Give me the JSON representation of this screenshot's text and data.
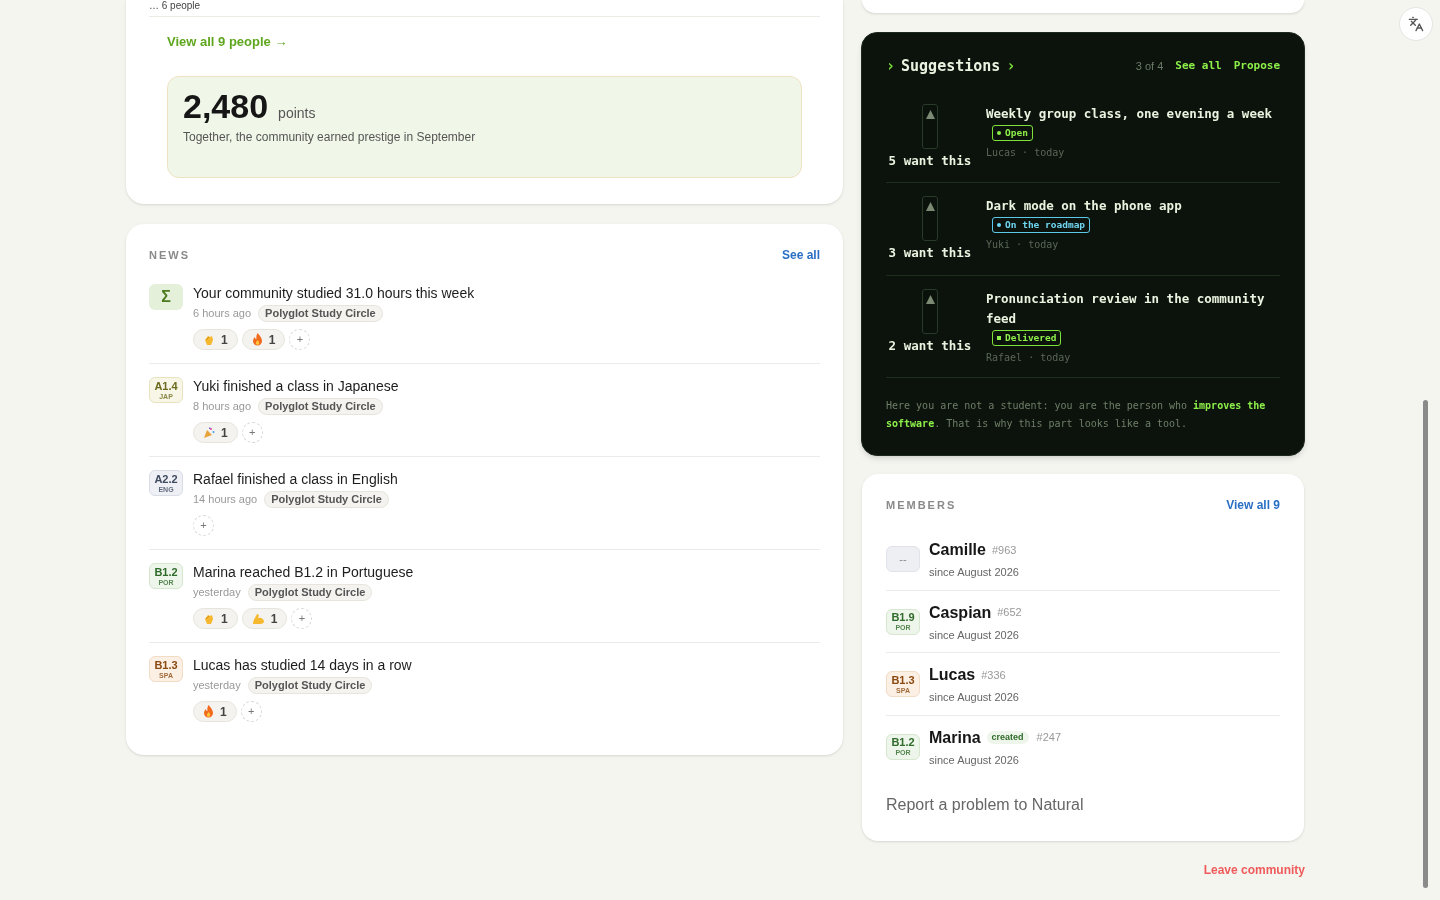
{
  "people_card": {
    "overflow_label": "… 6 people",
    "view_all": "View all 9 people →",
    "points": {
      "value": "2,480",
      "unit": "points",
      "caption": "Together, the community earned prestige in September"
    }
  },
  "news": {
    "title": "NEWS",
    "see_all": "See all",
    "items": [
      {
        "badge": {
          "kind": "stat",
          "glyph": "Σ"
        },
        "text": "Your community studied 31.0 hours this week",
        "time": "6 hours ago",
        "group": "Polyglot Study Circle",
        "reactions": [
          {
            "kind": "clap",
            "count": "1"
          },
          {
            "kind": "fire",
            "count": "1"
          }
        ],
        "add": "+"
      },
      {
        "badge": {
          "kind": "level",
          "level": "A1.4",
          "lang": "JAP",
          "color": "#6b6a1e"
        },
        "text": "Yuki finished a class in Japanese",
        "time": "8 hours ago",
        "group": "Polyglot Study Circle",
        "reactions": [
          {
            "kind": "party",
            "count": "1"
          }
        ],
        "add": "+"
      },
      {
        "badge": {
          "kind": "level",
          "level": "A2.2",
          "lang": "ENG",
          "color": "#3f4a5e"
        },
        "text": "Rafael finished a class in English",
        "time": "14 hours ago",
        "group": "Polyglot Study Circle",
        "add": "+"
      },
      {
        "badge": {
          "kind": "level",
          "level": "B1.2",
          "lang": "POR",
          "color": "#2f6b2a"
        },
        "text": "Marina reached B1.2 in Portuguese",
        "time": "yesterday",
        "group": "Polyglot Study Circle",
        "reactions": [
          {
            "kind": "clap",
            "count": "1"
          },
          {
            "kind": "muscle",
            "count": "1"
          }
        ],
        "add": "+"
      },
      {
        "badge": {
          "kind": "level",
          "level": "B1.3",
          "lang": "SPA",
          "color": "#8a4a12"
        },
        "text": "Lucas has studied 14 days in a row",
        "time": "yesterday",
        "group": "Polyglot Study Circle",
        "reactions": [
          {
            "kind": "fire",
            "count": "1"
          }
        ],
        "add": "+"
      }
    ]
  },
  "suggestions": {
    "title": "Suggestions",
    "prefix": "›",
    "suffix": "›",
    "count": "3 of 4",
    "see_all": "See all",
    "propose": "Propose",
    "items": [
      {
        "votes": "5 want this",
        "title": "Weekly group class, one evening a week",
        "status": {
          "kind": "open",
          "label": "Open"
        },
        "meta": "Lucas · today"
      },
      {
        "votes": "3 want this",
        "title": "Dark mode on the phone app",
        "status": {
          "kind": "roadmap",
          "label": "On the roadmap"
        },
        "meta": "Yuki · today"
      },
      {
        "votes": "2 want this",
        "title": "Pronunciation review in the community feed",
        "status": {
          "kind": "delivered",
          "label": "Delivered"
        },
        "meta": "Rafael · today"
      }
    ],
    "note": "Here you are not a student: you are the person who **improves the software**. That is why this part looks like a tool."
  },
  "members": {
    "title": "MEMBERS",
    "view_all": "View all 9",
    "items": [
      {
        "badge": {
          "kind": "empty",
          "text": "--"
        },
        "name": "Camille",
        "id": "#963",
        "since": "since August 2026"
      },
      {
        "badge": {
          "kind": "level",
          "level": "B1.9",
          "lang": "POR",
          "color": "#2f6b2a"
        },
        "name": "Caspian",
        "id": "#652",
        "since": "since August 2026"
      },
      {
        "badge": {
          "kind": "level",
          "level": "B1.3",
          "lang": "SPA",
          "color": "#8a4a12"
        },
        "name": "Lucas",
        "id": "#336",
        "since": "since August 2026"
      },
      {
        "badge": {
          "kind": "level",
          "level": "B1.2",
          "lang": "POR",
          "color": "#2f6b2a"
        },
        "name": "Marina",
        "tag": "created",
        "id": "#247",
        "since": "since August 2026"
      }
    ],
    "report": "Report a problem to Natural"
  },
  "leave": "Leave community"
}
